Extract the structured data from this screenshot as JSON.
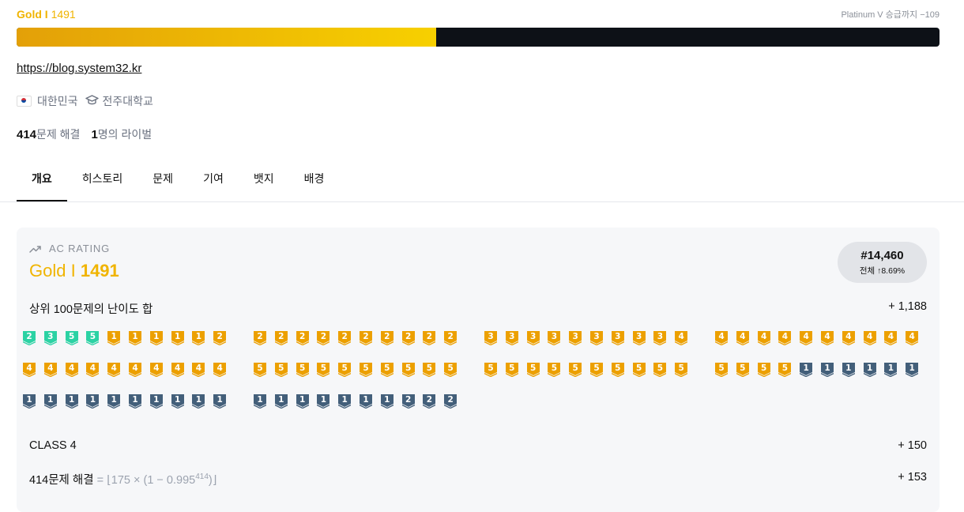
{
  "header": {
    "tier_name": "Gold I",
    "rating": "1491",
    "next_tier_text": "Platinum V 승급까지 −109",
    "progress_fraction": 0.455
  },
  "profile": {
    "blog_link": "https://blog.system32.kr",
    "country": "대한민국",
    "school": "전주대학교",
    "solved_count": "414",
    "solved_label": "문제 해결",
    "rival_count": "1",
    "rival_label": "명의 라이벌"
  },
  "tabs": [
    "개요",
    "히스토리",
    "문제",
    "기여",
    "뱃지",
    "배경"
  ],
  "rating_card": {
    "label": "AC RATING",
    "tier_name": "Gold I",
    "rating": "1491",
    "rank": "#14,460",
    "rank_sub": "전체 ↑8.69%",
    "top100_label": "상위 100문제의 난이도 합",
    "top100_value": "+ 1,188",
    "class_label": "CLASS 4",
    "class_value": "+ 150",
    "solved_label": "414문제 해결",
    "solved_formula_pre": "= ⌊175 × (1 − 0.995",
    "solved_formula_exp": "414",
    "solved_formula_post": ")⌋",
    "solved_value": "+ 153"
  },
  "problem_tiers": [
    "P2",
    "P3",
    "P5",
    "P5",
    "G1",
    "G1",
    "G1",
    "G1",
    "G1",
    "G2",
    "G2",
    "G2",
    "G2",
    "G2",
    "G2",
    "G2",
    "G2",
    "G2",
    "G2",
    "G2",
    "G3",
    "G3",
    "G3",
    "G3",
    "G3",
    "G3",
    "G3",
    "G3",
    "G3",
    "G4",
    "G4",
    "G4",
    "G4",
    "G4",
    "G4",
    "G4",
    "G4",
    "G4",
    "G4",
    "G4",
    "G4",
    "G4",
    "G4",
    "G4",
    "G4",
    "G4",
    "G4",
    "G4",
    "G4",
    "G4",
    "G5",
    "G5",
    "G5",
    "G5",
    "G5",
    "G5",
    "G5",
    "G5",
    "G5",
    "G5",
    "G5",
    "G5",
    "G5",
    "G5",
    "G5",
    "G5",
    "G5",
    "G5",
    "G5",
    "G5",
    "G5",
    "G5",
    "G5",
    "G5",
    "S1",
    "S1",
    "S1",
    "S1",
    "S1",
    "S1",
    "S1",
    "S1",
    "S1",
    "S1",
    "S1",
    "S1",
    "S1",
    "S1",
    "S1",
    "S1",
    "S1",
    "S1",
    "S1",
    "S1",
    "S1",
    "S1",
    "S1",
    "S2",
    "S2",
    "S2"
  ],
  "colors": {
    "gold": "#eca000",
    "platinum": "#2bd2a4",
    "silver": "#435f7a",
    "gold_text": "#f0b400"
  }
}
